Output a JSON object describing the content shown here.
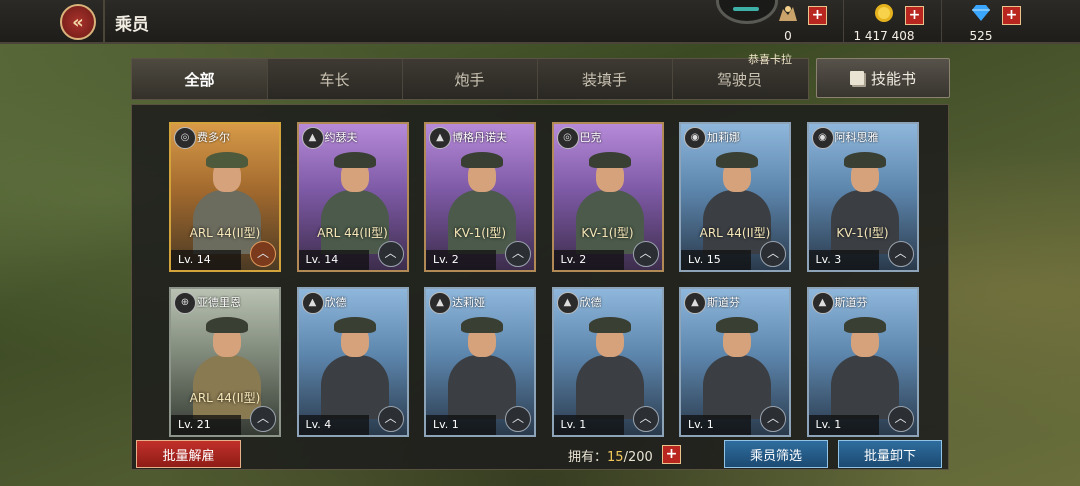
{
  "header": {
    "back_icon": "double-chevron-left-icon",
    "title": "乘员",
    "resources": [
      {
        "name": "medal",
        "icon": "medal-icon",
        "value": "0"
      },
      {
        "name": "gold",
        "icon": "gold-coin-icon",
        "value": "1 417 408"
      },
      {
        "name": "diamond",
        "icon": "diamond-icon",
        "value": "525"
      }
    ],
    "plus_glyph": "+"
  },
  "tabs": [
    "全部",
    "车长",
    "炮手",
    "装填手",
    "驾驶员"
  ],
  "active_tab": 0,
  "ticker": "恭喜卡拉",
  "skill_book_label": "技能书",
  "crew": [
    {
      "name": "费多尔",
      "tank": "ARL 44(II型)",
      "level": "Lv. 14",
      "rarity": "gold",
      "role_icon": "gunner-icon"
    },
    {
      "name": "约瑟夫",
      "tank": "ARL 44(II型)",
      "level": "Lv. 14",
      "rarity": "purple",
      "role_icon": "commander-icon"
    },
    {
      "name": "博格丹诺夫",
      "tank": "KV-1(I型)",
      "level": "Lv. 2",
      "rarity": "purple",
      "role_icon": "commander-icon"
    },
    {
      "name": "巴克",
      "tank": "KV-1(I型)",
      "level": "Lv. 2",
      "rarity": "purple",
      "role_icon": "gunner-icon"
    },
    {
      "name": "加莉娜",
      "tank": "ARL 44(II型)",
      "level": "Lv. 15",
      "rarity": "blue",
      "role_icon": "driver-icon"
    },
    {
      "name": "阿科思雅",
      "tank": "KV-1(I型)",
      "level": "Lv. 3",
      "rarity": "blue",
      "role_icon": "driver-icon"
    },
    {
      "name": "亚德里恩",
      "tank": "ARL 44(II型)",
      "level": "Lv. 21",
      "rarity": "gray",
      "role_icon": "loader-icon"
    },
    {
      "name": "欣德",
      "tank": "",
      "level": "Lv. 4",
      "rarity": "blue",
      "role_icon": "commander-icon"
    },
    {
      "name": "达莉娅",
      "tank": "",
      "level": "Lv. 1",
      "rarity": "blue",
      "role_icon": "commander-icon"
    },
    {
      "name": "欣德",
      "tank": "",
      "level": "Lv. 1",
      "rarity": "blue",
      "role_icon": "commander-icon"
    },
    {
      "name": "斯道芬",
      "tank": "",
      "level": "Lv. 1",
      "rarity": "blue",
      "role_icon": "commander-icon"
    },
    {
      "name": "斯道芬",
      "tank": "",
      "level": "Lv. 1",
      "rarity": "blue",
      "role_icon": "commander-icon"
    }
  ],
  "footer": {
    "dismiss_label": "批量解雇",
    "owned_label": "拥有：",
    "owned_current": "15",
    "owned_max": "/200",
    "filter_label": "乘员筛选",
    "unload_label": "批量卸下"
  },
  "colors": {
    "accent_red": "#b9261f",
    "accent_blue": "#2f6d9e",
    "gold": "#d3a43c"
  }
}
